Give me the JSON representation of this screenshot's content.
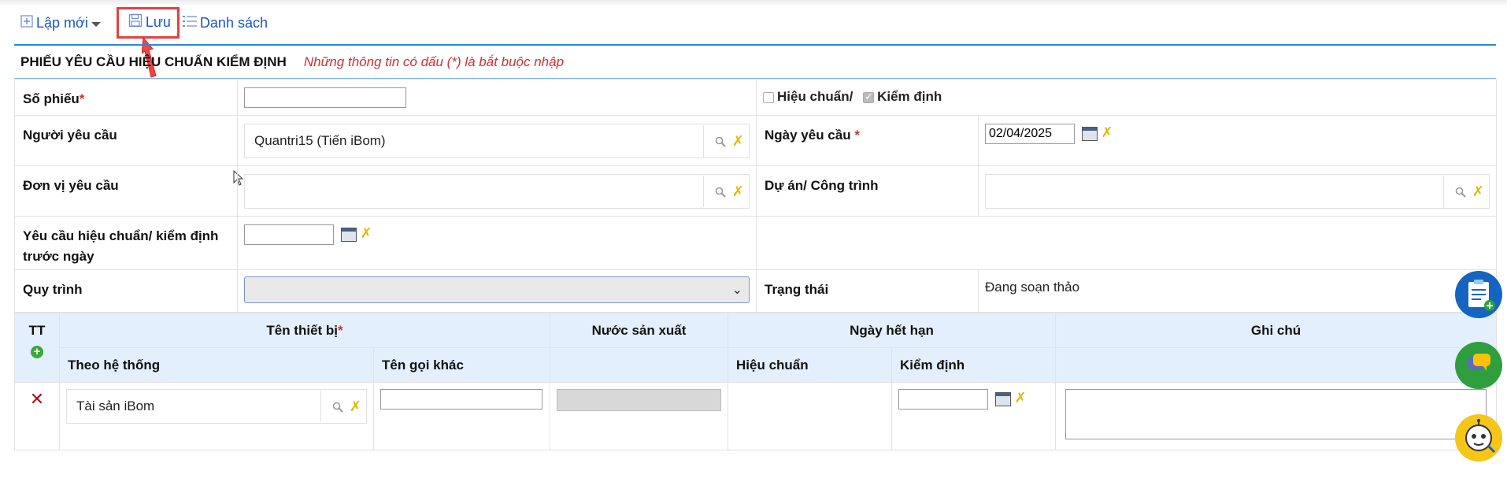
{
  "toolbar": {
    "new_label": "Lập mới",
    "save_label": "Lưu",
    "list_label": "Danh sách"
  },
  "form": {
    "title": "PHIẾU YÊU CẦU HIỆU CHUẨN KIỂM ĐỊNH",
    "note": "Những thông tin có dấu (*) là bắt buộc nhập",
    "so_phieu_label": "Số phiếu",
    "so_phieu_value": "",
    "hieu_chuan_label": "Hiệu chuẩn/",
    "kiem_dinh_label": "Kiểm định",
    "nguoi_yeu_cau_label": "Người yêu cầu",
    "nguoi_yeu_cau_value": "Quantri15 (Tiến iBom)",
    "ngay_yeu_cau_label": "Ngày yêu cầu",
    "ngay_yeu_cau_value": "02/04/2025",
    "don_vi_label": "Đơn vị yêu cầu",
    "du_an_label": "Dự án/ Công trình",
    "yeu_cau_truoc_label": "Yêu cầu hiệu chuẩn/ kiểm định trước ngày",
    "quy_trinh_label": "Quy trình",
    "trang_thai_label": "Trạng thái",
    "trang_thai_value": "Đang soạn thảo",
    "required_mark": "*"
  },
  "grid": {
    "col_tt": "TT",
    "col_ten_thiet_bi": "Tên thiết bị",
    "col_nuoc_sx": "Nước sản xuất",
    "col_ngay_het_han": "Ngày hết hạn",
    "col_ghi_chu": "Ghi chú",
    "sub_theo_he_thong": "Theo hệ thống",
    "sub_ten_goi_khac": "Tên gọi khác",
    "sub_hieu_chuan": "Hiệu chuẩn",
    "sub_kiem_dinh": "Kiểm định",
    "rows": [
      {
        "theo_he_thong": "Tài sản iBom"
      }
    ]
  },
  "colors": {
    "accent": "#1a56c9",
    "required": "#d32f2f",
    "header_bg": "#e3effc",
    "highlight": "#e64040"
  }
}
